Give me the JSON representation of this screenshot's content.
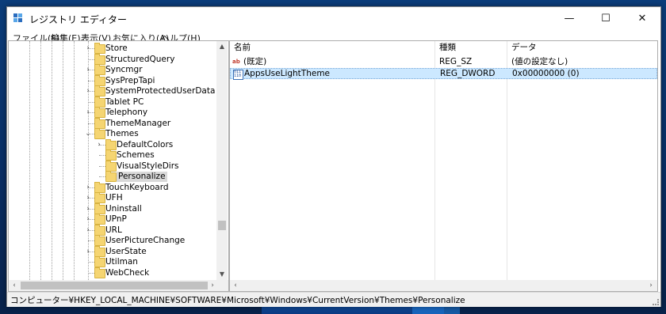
{
  "window": {
    "title": "レジストリ エディター",
    "controls": {
      "minimize": "—",
      "maximize": "☐",
      "close": "✕"
    }
  },
  "menu": [
    "ファイル(F)",
    "編集(E)",
    "表示(V)",
    "お気に入り(A)",
    "ヘルプ(H)"
  ],
  "tree": {
    "items": [
      {
        "label": "Store",
        "expander": "›"
      },
      {
        "label": "StructuredQuery",
        "expander": ""
      },
      {
        "label": "Syncmgr",
        "expander": "›"
      },
      {
        "label": "SysPrepTapi",
        "expander": ""
      },
      {
        "label": "SystemProtectedUserData",
        "expander": "›"
      },
      {
        "label": "Tablet PC",
        "expander": ""
      },
      {
        "label": "Telephony",
        "expander": "›"
      },
      {
        "label": "ThemeManager",
        "expander": ""
      },
      {
        "label": "Themes",
        "expander": "⌄"
      },
      {
        "label": "DefaultColors",
        "expander": "›"
      },
      {
        "label": "Schemes",
        "expander": ""
      },
      {
        "label": "VisualStyleDirs",
        "expander": ""
      },
      {
        "label": "Personalize",
        "expander": ""
      },
      {
        "label": "TouchKeyboard",
        "expander": "›"
      },
      {
        "label": "UFH",
        "expander": "›"
      },
      {
        "label": "Uninstall",
        "expander": "›"
      },
      {
        "label": "UPnP",
        "expander": "›"
      },
      {
        "label": "URL",
        "expander": "›"
      },
      {
        "label": "UserPictureChange",
        "expander": ""
      },
      {
        "label": "UserState",
        "expander": "›"
      },
      {
        "label": "Utilman",
        "expander": ""
      },
      {
        "label": "WebCheck",
        "expander": ""
      }
    ],
    "selected": "Personalize"
  },
  "list": {
    "headers": {
      "name": "名前",
      "type": "種類",
      "data": "データ"
    },
    "rows": [
      {
        "icon": "ab",
        "name": "(既定)",
        "type": "REG_SZ",
        "data": "(値の設定なし)"
      },
      {
        "icon": "bin",
        "name": "AppsUseLightTheme",
        "type": "REG_DWORD",
        "data": "0x00000000 (0)"
      }
    ]
  },
  "status": "コンピューター¥HKEY_LOCAL_MACHINE¥SOFTWARE¥Microsoft¥Windows¥CurrentVersion¥Themes¥Personalize",
  "icons": {
    "ab": "ab",
    "bin": "011\n110"
  },
  "colors": {
    "selection_row": "#cce8ff",
    "folder": "#f5d572"
  }
}
